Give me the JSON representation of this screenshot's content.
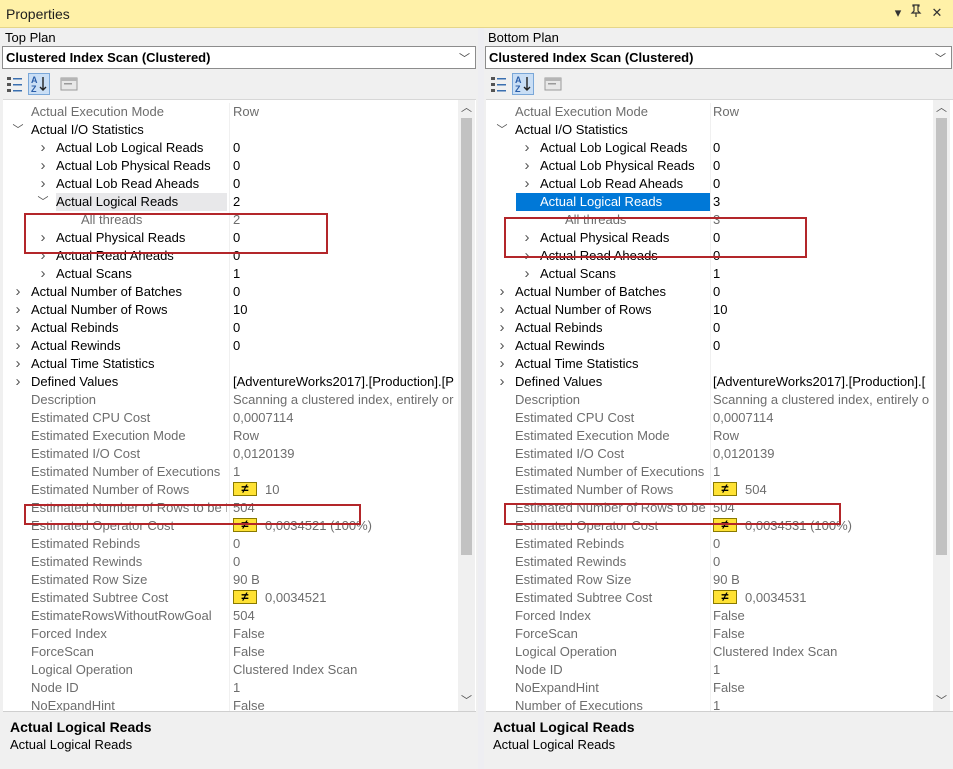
{
  "window": {
    "title": "Properties"
  },
  "panes": [
    {
      "label": "Top Plan",
      "combo_value": "Clustered Index Scan (Clustered)",
      "desc_title": "Actual Logical Reads",
      "desc_text": "Actual Logical Reads",
      "rows": [
        {
          "name": "Actual Execution Mode",
          "value": "Row",
          "level": 0,
          "exp": "",
          "dim": true
        },
        {
          "name": "Actual I/O Statistics",
          "value": "",
          "level": 0,
          "exp": "open",
          "dim": false
        },
        {
          "name": "Actual Lob Logical Reads",
          "value": "0",
          "level": 1,
          "exp": "closed",
          "dim": false
        },
        {
          "name": "Actual Lob Physical Reads",
          "value": "0",
          "level": 1,
          "exp": "closed",
          "dim": false
        },
        {
          "name": "Actual Lob Read Aheads",
          "value": "0",
          "level": 1,
          "exp": "closed",
          "dim": false
        },
        {
          "name": "Actual Logical Reads",
          "value": "2",
          "level": 1,
          "exp": "open",
          "dim": false,
          "hover": true
        },
        {
          "name": "All threads",
          "value": "2",
          "level": 2,
          "exp": "",
          "dim": true
        },
        {
          "name": "Actual Physical Reads",
          "value": "0",
          "level": 1,
          "exp": "closed",
          "dim": false
        },
        {
          "name": "Actual Read Aheads",
          "value": "0",
          "level": 1,
          "exp": "closed",
          "dim": false
        },
        {
          "name": "Actual Scans",
          "value": "1",
          "level": 1,
          "exp": "closed",
          "dim": false
        },
        {
          "name": "Actual Number of Batches",
          "value": "0",
          "level": 0,
          "exp": "closed",
          "dim": false
        },
        {
          "name": "Actual Number of Rows",
          "value": "10",
          "level": 0,
          "exp": "closed",
          "dim": false
        },
        {
          "name": "Actual Rebinds",
          "value": "0",
          "level": 0,
          "exp": "closed",
          "dim": false
        },
        {
          "name": "Actual Rewinds",
          "value": "0",
          "level": 0,
          "exp": "closed",
          "dim": false
        },
        {
          "name": "Actual Time Statistics",
          "value": "",
          "level": 0,
          "exp": "closed",
          "dim": false
        },
        {
          "name": "Defined Values",
          "value": "[AdventureWorks2017].[Production].[P",
          "level": 0,
          "exp": "closed",
          "dim": false
        },
        {
          "name": "Description",
          "value": "Scanning a clustered index, entirely or",
          "level": 0,
          "exp": "",
          "dim": true
        },
        {
          "name": "Estimated CPU Cost",
          "value": "0,0007114",
          "level": 0,
          "exp": "",
          "dim": true
        },
        {
          "name": "Estimated Execution Mode",
          "value": "Row",
          "level": 0,
          "exp": "",
          "dim": true
        },
        {
          "name": "Estimated I/O Cost",
          "value": "0,0120139",
          "level": 0,
          "exp": "",
          "dim": true
        },
        {
          "name": "Estimated Number of Executions",
          "value": "1",
          "level": 0,
          "exp": "",
          "dim": true
        },
        {
          "name": "Estimated Number of Rows",
          "value": "10",
          "level": 0,
          "exp": "",
          "dim": true,
          "neq": true
        },
        {
          "name": "Estimated Number of Rows to be Read",
          "value": "504",
          "level": 0,
          "exp": "",
          "dim": true
        },
        {
          "name": "Estimated Operator Cost",
          "value": "0,0034521 (100%)",
          "level": 0,
          "exp": "",
          "dim": true,
          "neq": true
        },
        {
          "name": "Estimated Rebinds",
          "value": "0",
          "level": 0,
          "exp": "",
          "dim": true
        },
        {
          "name": "Estimated Rewinds",
          "value": "0",
          "level": 0,
          "exp": "",
          "dim": true
        },
        {
          "name": "Estimated Row Size",
          "value": "90 B",
          "level": 0,
          "exp": "",
          "dim": true
        },
        {
          "name": "Estimated Subtree Cost",
          "value": "0,0034521",
          "level": 0,
          "exp": "",
          "dim": true,
          "neq": true
        },
        {
          "name": "EstimateRowsWithoutRowGoal",
          "value": "504",
          "level": 0,
          "exp": "",
          "dim": true
        },
        {
          "name": "Forced Index",
          "value": "False",
          "level": 0,
          "exp": "",
          "dim": true
        },
        {
          "name": "ForceScan",
          "value": "False",
          "level": 0,
          "exp": "",
          "dim": true
        },
        {
          "name": "Logical Operation",
          "value": "Clustered Index Scan",
          "level": 0,
          "exp": "",
          "dim": true
        },
        {
          "name": "Node ID",
          "value": "1",
          "level": 0,
          "exp": "",
          "dim": true
        },
        {
          "name": "NoExpandHint",
          "value": "False",
          "level": 0,
          "exp": "",
          "dim": true
        }
      ]
    },
    {
      "label": "Bottom Plan",
      "combo_value": "Clustered Index Scan (Clustered)",
      "desc_title": "Actual Logical Reads",
      "desc_text": "Actual Logical Reads",
      "rows": [
        {
          "name": "Actual Execution Mode",
          "value": "Row",
          "level": 0,
          "exp": "",
          "dim": true
        },
        {
          "name": "Actual I/O Statistics",
          "value": "",
          "level": 0,
          "exp": "open",
          "dim": false
        },
        {
          "name": "Actual Lob Logical Reads",
          "value": "0",
          "level": 1,
          "exp": "closed",
          "dim": false
        },
        {
          "name": "Actual Lob Physical Reads",
          "value": "0",
          "level": 1,
          "exp": "closed",
          "dim": false
        },
        {
          "name": "Actual Lob Read Aheads",
          "value": "0",
          "level": 1,
          "exp": "closed",
          "dim": false
        },
        {
          "name": "Actual Logical Reads",
          "value": "3",
          "level": 1,
          "exp": "open",
          "dim": false,
          "selected": true
        },
        {
          "name": "All threads",
          "value": "3",
          "level": 2,
          "exp": "",
          "dim": true
        },
        {
          "name": "Actual Physical Reads",
          "value": "0",
          "level": 1,
          "exp": "closed",
          "dim": false
        },
        {
          "name": "Actual Read Aheads",
          "value": "0",
          "level": 1,
          "exp": "closed",
          "dim": false
        },
        {
          "name": "Actual Scans",
          "value": "1",
          "level": 1,
          "exp": "closed",
          "dim": false
        },
        {
          "name": "Actual Number of Batches",
          "value": "0",
          "level": 0,
          "exp": "closed",
          "dim": false
        },
        {
          "name": "Actual Number of Rows",
          "value": "10",
          "level": 0,
          "exp": "closed",
          "dim": false
        },
        {
          "name": "Actual Rebinds",
          "value": "0",
          "level": 0,
          "exp": "closed",
          "dim": false
        },
        {
          "name": "Actual Rewinds",
          "value": "0",
          "level": 0,
          "exp": "closed",
          "dim": false
        },
        {
          "name": "Actual Time Statistics",
          "value": "",
          "level": 0,
          "exp": "closed",
          "dim": false
        },
        {
          "name": "Defined Values",
          "value": "[AdventureWorks2017].[Production].[",
          "level": 0,
          "exp": "closed",
          "dim": false
        },
        {
          "name": "Description",
          "value": "Scanning a clustered index, entirely o",
          "level": 0,
          "exp": "",
          "dim": true
        },
        {
          "name": "Estimated CPU Cost",
          "value": "0,0007114",
          "level": 0,
          "exp": "",
          "dim": true
        },
        {
          "name": "Estimated Execution Mode",
          "value": "Row",
          "level": 0,
          "exp": "",
          "dim": true
        },
        {
          "name": "Estimated I/O Cost",
          "value": "0,0120139",
          "level": 0,
          "exp": "",
          "dim": true
        },
        {
          "name": "Estimated Number of Executions",
          "value": "1",
          "level": 0,
          "exp": "",
          "dim": true
        },
        {
          "name": "Estimated Number of Rows",
          "value": "504",
          "level": 0,
          "exp": "",
          "dim": true,
          "neq": true
        },
        {
          "name": "Estimated Number of Rows to be Read",
          "value": "504",
          "level": 0,
          "exp": "",
          "dim": true
        },
        {
          "name": "Estimated Operator Cost",
          "value": "0,0034531 (100%)",
          "level": 0,
          "exp": "",
          "dim": true,
          "neq": true
        },
        {
          "name": "Estimated Rebinds",
          "value": "0",
          "level": 0,
          "exp": "",
          "dim": true
        },
        {
          "name": "Estimated Rewinds",
          "value": "0",
          "level": 0,
          "exp": "",
          "dim": true
        },
        {
          "name": "Estimated Row Size",
          "value": "90 B",
          "level": 0,
          "exp": "",
          "dim": true
        },
        {
          "name": "Estimated Subtree Cost",
          "value": "0,0034531",
          "level": 0,
          "exp": "",
          "dim": true,
          "neq": true
        },
        {
          "name": "Forced Index",
          "value": "False",
          "level": 0,
          "exp": "",
          "dim": true
        },
        {
          "name": "ForceScan",
          "value": "False",
          "level": 0,
          "exp": "",
          "dim": true
        },
        {
          "name": "Logical Operation",
          "value": "Clustered Index Scan",
          "level": 0,
          "exp": "",
          "dim": true
        },
        {
          "name": "Node ID",
          "value": "1",
          "level": 0,
          "exp": "",
          "dim": true
        },
        {
          "name": "NoExpandHint",
          "value": "False",
          "level": 0,
          "exp": "",
          "dim": true
        },
        {
          "name": "Number of Executions",
          "value": "1",
          "level": 0,
          "exp": "",
          "dim": true
        }
      ]
    }
  ],
  "colors": {
    "titlebar": "#fff1a8",
    "selection": "#0078d7",
    "highlight_box": "#b3262a",
    "neq_badge": "#ffe234"
  },
  "icons": [
    "categorized-icon",
    "alphabetical-sort-icon",
    "property-pages-icon",
    "neq-warning-icon"
  ]
}
